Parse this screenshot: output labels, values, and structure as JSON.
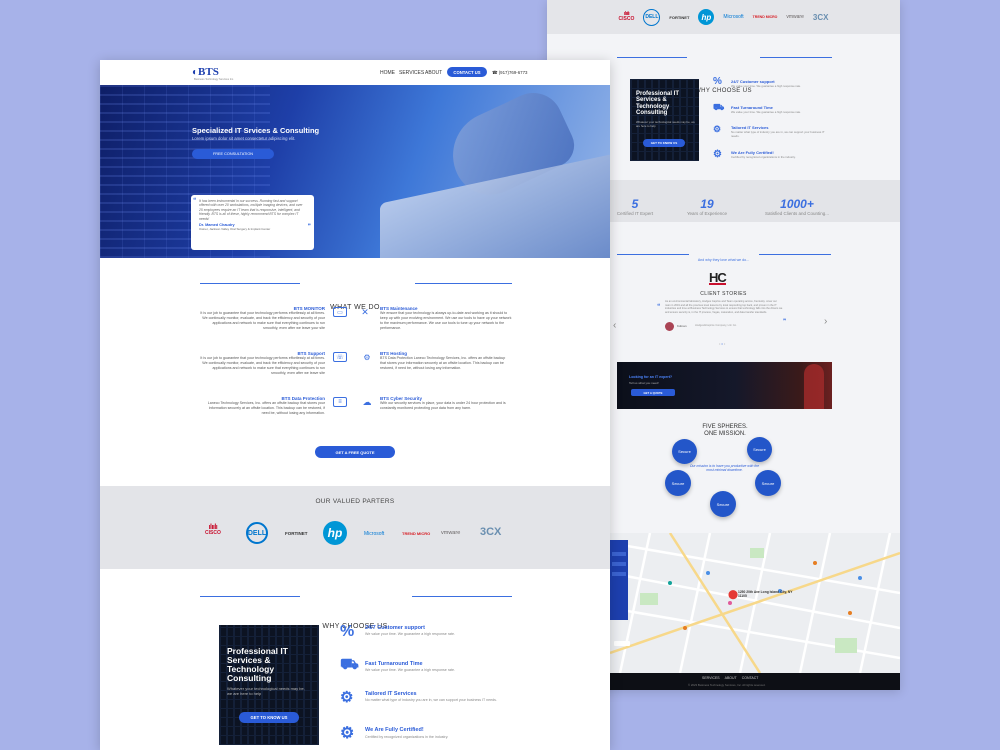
{
  "right": {
    "partners_logos": [
      {
        "text": "CISCO",
        "color": "#c8102e",
        "icon": "cisco-bars-icon"
      },
      {
        "text": "DELL",
        "color": "#0076ce",
        "icon": "dell-circle-icon"
      },
      {
        "text": "FORTINET",
        "color": "#333333",
        "icon": "fortinet-icon"
      },
      {
        "text": "hp",
        "color": "#0096d6",
        "icon": "hp-circle-icon"
      },
      {
        "text": "Microsoft",
        "color": "#0078d4",
        "icon": "microsoft-icon"
      },
      {
        "text": "TREND MICRO",
        "color": "#d71920",
        "icon": "trend-micro-icon"
      },
      {
        "text": "vmware",
        "color": "#696566",
        "icon": "vmware-icon"
      },
      {
        "text": "3CX",
        "color": "#6a8fb0",
        "icon": "3cx-icon"
      }
    ],
    "why_title": "WHY CHOOSE US",
    "card": {
      "title": "Professional IT Services & Technology Consulting",
      "sub": "Whatever your technological needs may be, we are here to help",
      "button": "GET TO KNOW US"
    },
    "features": [
      {
        "title": "24/7 Customer support",
        "desc": "We value your time. We guarantee a high response rate.",
        "icon": "percent-icon"
      },
      {
        "title": "Fast Turnaround Time",
        "desc": "We value your time. We guarantee a high response rate.",
        "icon": "truck-icon"
      },
      {
        "title": "Tailored IT Services",
        "desc": "No matter what type of industry you are in, we can support your business IT needs.",
        "icon": "gears-icon"
      },
      {
        "title": "We Are Fully Certified!",
        "desc": "Certified by recognized organizations in the industry.",
        "icon": "gear-check-icon"
      }
    ],
    "stats": [
      {
        "num": "5",
        "label": "Certified IT Expert"
      },
      {
        "num": "19",
        "label": "Years of Experience"
      },
      {
        "num": "1000+",
        "label": "Satisfied Clients and Counting..."
      }
    ],
    "client_title": "CLIENT STORIES",
    "client_sub": "And why they love what we do...",
    "client_logo": "HC",
    "client_quote": "As an environmental laboratory, Hodges Caprice and Team operating across, Kentucky. cover our main in 2019 and all the previous level lessons by local responding top back, and proven in the IT industries and time at Business Technology Services to ensure that technology falls into the drivers we and ensure security is, in the IT process, Vegas, maturation, and data transfer standards.",
    "client_name": "Kdman",
    "client_role": "Hodges&Caprice Company, Ltd. Co.",
    "cta": {
      "title": "Looking for an IT expert?",
      "sub": "Tell us what you need!",
      "button": "GET A QUOTE"
    },
    "spheres_title": "FIVE SPHERES.\nONE MISSION.",
    "spheres_center": "Our mission is to have you productive with the most minimal downtime.",
    "sphere_label": "Secure",
    "map_label": "1250 20th Ave Long Island City, NY 11105",
    "footer_links": [
      "SERVICES",
      "ABOUT",
      "CONTACT"
    ],
    "footer_copy": "© 2023 Business Technology Services, Inc. All rights reserved."
  },
  "left": {
    "logo": "BTS",
    "logo_sub": "Business Technology Services Inc.",
    "nav": [
      "HOME",
      "SERVICES",
      "ABOUT"
    ],
    "contact_btn": "CONTACT US",
    "phone": "☎ (917)769-6773",
    "hero_title": "Specialized IT Srvices & Consulting",
    "hero_sub": "Lorem ipsum dolor sit amet consectetur adipiscing elit.",
    "hero_btn": "FREE CONSULTATION",
    "quote_text": "It has been instrumental in our success. Running fast and support offered with over 20 workstations, multiple imaging devices, and over 25 employees require an IT team that is responsive, intelligent, and friendly. BTS is all of these, highly recommend BTS for complex IT needs!",
    "quote_name": "Dr. Mamed Chaudry",
    "quote_role": "Owner, Jackson Valley Oral Surgery & Implant Center",
    "wwd_title": "WHAT WE DO",
    "services": [
      {
        "title": "BTS MONITOR",
        "desc": "It is our job to guarantee that your technology performs effortlessly at all times. We continually monitor, evaluate, and track the efficiency and security of your applications and network to make sure that everything continues to run smoothly, even after we leave your site",
        "icon": "monitor-icon"
      },
      {
        "title": "BTS Maintenance",
        "desc": "We ensure that your technology is always up-to-date and working as it should to keep up with your evolving environment. We use our tools to have up your network to the maximum performance. We use our tools to tune up your network to the performance.",
        "icon": "wrench-icon"
      },
      {
        "title": "BTS Support",
        "desc": "It is our job to guarantee that your technology performs effortlessly at all times. We continually monitor, evaluate, and track the efficiency and security of your applications and network to make sure that everything continues to run smoothly, even after we leave site",
        "icon": "support-icon"
      },
      {
        "title": "BTS Hosting",
        "desc": "BTS Data Protection Laneco Technology Services, Inc. offers an offsite backup that stores your information securely at an offsite location. This backup can be restored, if need be, without losing any information.",
        "icon": "hosting-icon"
      },
      {
        "title": "BTS Data Protection",
        "desc": "Laneco Technology Services, Inc. offers an offsite backup that stores your information securely at an offsite location. This backup can be restored, if need be, without losing any information.",
        "icon": "server-icon"
      },
      {
        "title": "BTS Cyber Security",
        "desc": "With our security services in place, your data is under 24 hour protection and is constantly monitored protecting your data from any harm.",
        "icon": "cloud-icon"
      }
    ],
    "quote_btn": "GET A FREE QUOTE",
    "partners_title": "OUR VALUED PARTERS",
    "partners_logos": [
      {
        "text": "CISCO",
        "color": "#c8102e",
        "icon": "cisco-bars-icon"
      },
      {
        "text": "DELL",
        "color": "#0076ce",
        "icon": "dell-circle-icon"
      },
      {
        "text": "FORTINET",
        "color": "#333333",
        "icon": "fortinet-icon"
      },
      {
        "text": "hp",
        "color": "#0096d6",
        "icon": "hp-circle-icon"
      },
      {
        "text": "Microsoft",
        "color": "#0078d4",
        "icon": "microsoft-icon"
      },
      {
        "text": "TREND MICRO",
        "color": "#d71920",
        "icon": "trend-micro-icon"
      },
      {
        "text": "vmware",
        "color": "#696566",
        "icon": "vmware-icon"
      },
      {
        "text": "3CX",
        "color": "#6a8fb0",
        "icon": "3cx-icon"
      }
    ],
    "why_title": "WHY CHOOSE US",
    "card": {
      "title": "Professional IT Services & Technology Consulting",
      "sub": "Whatever your technological needs may be, we are here to help",
      "button": "GET TO KNOW US"
    },
    "features": [
      {
        "title": "24/7 Customer support",
        "desc": "We value your time. We guarantee a high response rate.",
        "icon": "percent-icon"
      },
      {
        "title": "Fast Turnaround Time",
        "desc": "We value your time. We guarantee a high response rate.",
        "icon": "truck-icon"
      },
      {
        "title": "Tailored IT Services",
        "desc": "No matter what type of industry you are in, we can support your business IT needs.",
        "icon": "gears-icon"
      },
      {
        "title": "We Are Fully Certified!",
        "desc": "Certified by recognized organizations in the industry.",
        "icon": "gear-check-icon"
      }
    ]
  },
  "colors": {
    "accent": "#2a5bd7",
    "background": "#a7b2e9",
    "hero_dark": "#0e1e66"
  }
}
